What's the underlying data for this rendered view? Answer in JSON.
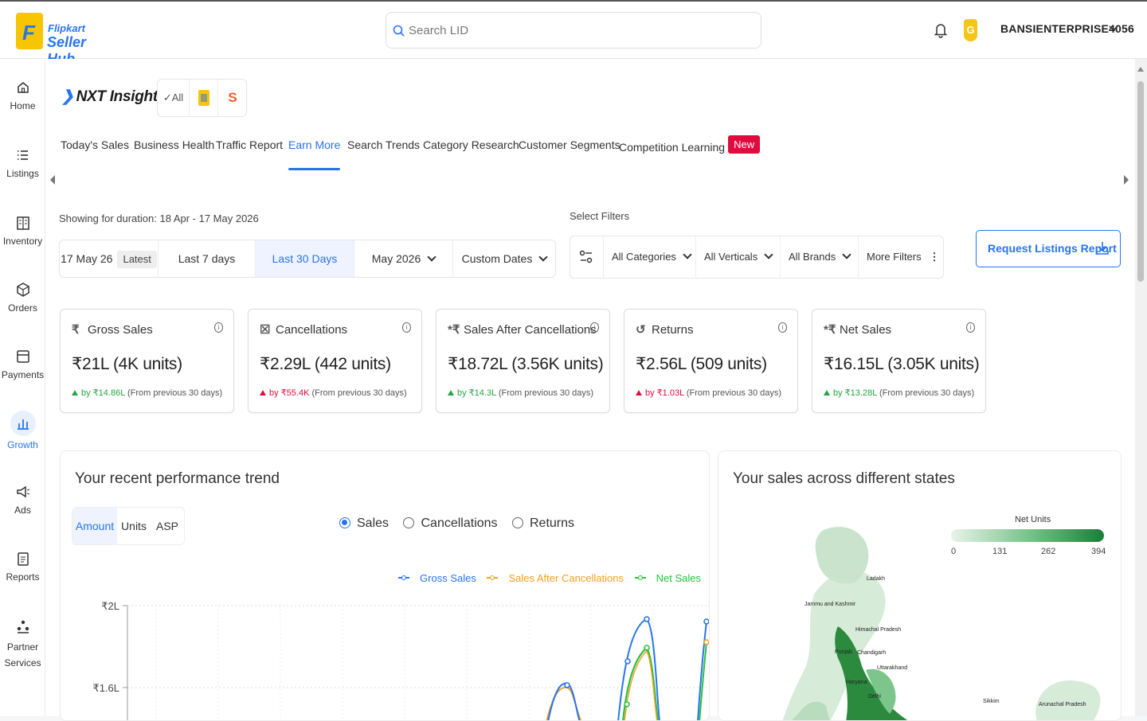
{
  "header": {
    "logo_line1": "Flipkart",
    "logo_line2": "Seller Hub",
    "logo_letter": "F",
    "search_placeholder": "Search LID",
    "account_badge": "G",
    "account_name": "BANSIENTERPRISE4056"
  },
  "sidenav": [
    {
      "label": "Home",
      "icon": "home-icon"
    },
    {
      "label": "Listings",
      "icon": "listings-icon"
    },
    {
      "label": "Inventory",
      "icon": "inventory-icon"
    },
    {
      "label": "Orders",
      "icon": "orders-icon"
    },
    {
      "label": "Payments",
      "icon": "payments-icon"
    },
    {
      "label": "Growth",
      "icon": "growth-icon"
    },
    {
      "label": "Ads",
      "icon": "ads-icon"
    },
    {
      "label": "Reports",
      "icon": "reports-icon"
    },
    {
      "label": "Partner Services",
      "icon": "partner-services-icon"
    }
  ],
  "nxt": {
    "title": "NXT Insights",
    "brand_all": "All",
    "brand_s": "S"
  },
  "tabs": [
    "Today's Sales",
    "Business Health",
    "Traffic Report",
    "Earn More",
    "Search Trends",
    "Category Research",
    "Customer Segments",
    "Competition Learning"
  ],
  "active_tab": "Earn More",
  "new_badge": "New",
  "duration_text": "Showing for duration: 18 Apr - 17 May 2026",
  "select_filters_label": "Select Filters",
  "date_options": {
    "today": "17 May 26",
    "latest": "Latest",
    "last7": "Last 7 days",
    "last30": "Last 30 Days",
    "month": "May 2026",
    "custom": "Custom Dates"
  },
  "filters": {
    "categories": "All Categories",
    "verticals": "All Verticals",
    "brands": "All Brands",
    "more": "More Filters"
  },
  "request_btn": "Request Listings Report",
  "cards": [
    {
      "title": "Gross Sales",
      "icon": "₹",
      "value": "₹21L (4K units)",
      "delta": "by ₹14.86L",
      "suffix": "(From previous 30 days)",
      "dir": "up"
    },
    {
      "title": "Cancellations",
      "icon": "☒",
      "value": "₹2.29L (442 units)",
      "delta": "by ₹55.4K",
      "suffix": "(From previous 30 days)",
      "dir": "down"
    },
    {
      "title": "Sales After Cancellations",
      "icon": "*₹",
      "value": "₹18.72L (3.56K units)",
      "delta": "by ₹14.3L",
      "suffix": "(From previous 30 days)",
      "dir": "up"
    },
    {
      "title": "Returns",
      "icon": "↺",
      "value": "₹2.56L (509 units)",
      "delta": "by ₹1.03L",
      "suffix": "(From previous 30 days)",
      "dir": "down"
    },
    {
      "title": "Net Sales",
      "icon": "*₹",
      "value": "₹16.15L (3.05K units)",
      "delta": "by ₹13.28L",
      "suffix": "(From previous 30 days)",
      "dir": "up"
    }
  ],
  "trend": {
    "title": "Your recent performance trend",
    "modes": [
      "Amount",
      "Units",
      "ASP"
    ],
    "radios": [
      "Sales",
      "Cancellations",
      "Returns"
    ],
    "legend": [
      "Gross Sales",
      "Sales After Cancellations",
      "Net Sales"
    ],
    "colors": {
      "gross": "#2874f0",
      "after": "#f0a020",
      "net": "#26c23b"
    },
    "y_ticks": [
      "₹2L",
      "₹1.6L"
    ]
  },
  "states": {
    "title": "Your sales across different states",
    "scale_title": "Net Units",
    "scale_ticks": [
      "0",
      "131",
      "262",
      "394"
    ],
    "labels": [
      "Ladakh",
      "Jammu and Kashmir",
      "Himachal Pradesh",
      "Punjab",
      "Chandigarh",
      "Uttarakhand",
      "Haryana",
      "Delhi",
      "Sikkim",
      "Arunachal Pradesh"
    ]
  }
}
